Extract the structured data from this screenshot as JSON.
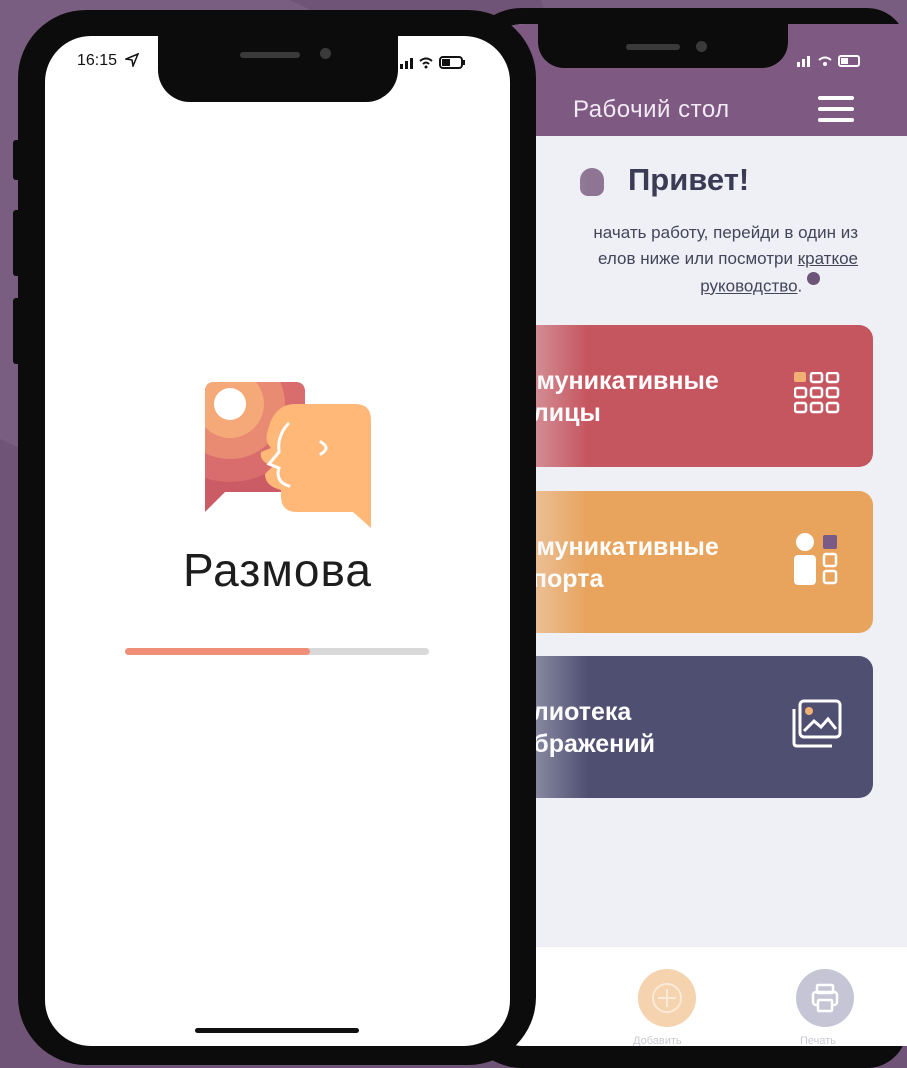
{
  "front_phone": {
    "time": "16:15",
    "app_name": "Размова",
    "loading_progress": 0.61
  },
  "back_phone": {
    "header_title": "Рабочий стол",
    "greeting": "Привет!",
    "intro": {
      "line1": "начать работу, перейди в один из",
      "line2_prefix": "елов ниже или посмотри ",
      "line2_link": "краткое",
      "line3_link": "руководство",
      "line3_suffix": "."
    },
    "cards": [
      {
        "line1": "ммуникативные",
        "line2": "блицы",
        "color": "#c5555e",
        "icon": "grid-icon"
      },
      {
        "line1": "ммуникативные",
        "line2": "спорта",
        "color": "#e8a35d",
        "icon": "people-icon"
      },
      {
        "line1": "блиотека",
        "line2": "ображений",
        "color": "#4f4f72",
        "icon": "gallery-icon"
      }
    ],
    "bottom_nav": {
      "add_label": "Добавить",
      "print_label": "Печать"
    }
  },
  "colors": {
    "background": "#6f5477",
    "header": "#7e5a83",
    "progress_fill": "#f08f78"
  }
}
